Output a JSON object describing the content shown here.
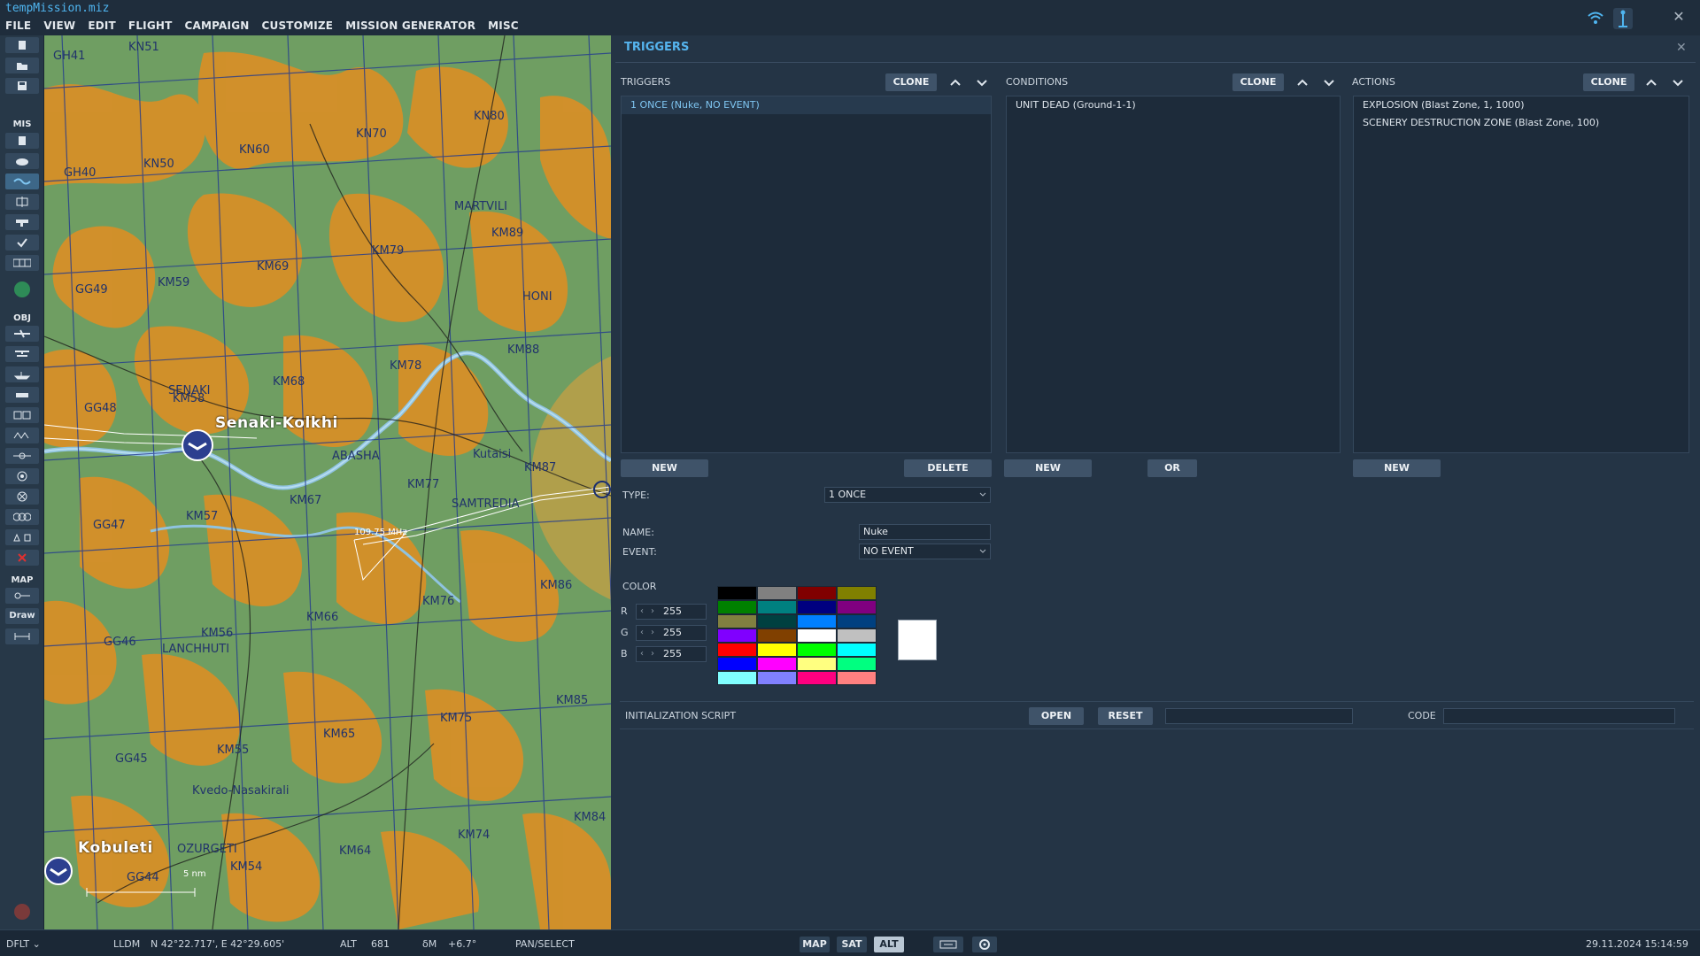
{
  "app": {
    "title": "tempMission.miz"
  },
  "menu": [
    "FILE",
    "VIEW",
    "EDIT",
    "FLIGHT",
    "CAMPAIGN",
    "CUSTOMIZE",
    "MISSION GENERATOR",
    "MISC"
  ],
  "toolbar": {
    "sections": {
      "mis": "MIS",
      "obj": "OBJ",
      "map": "MAP"
    },
    "draw_label": "Draw"
  },
  "map": {
    "grid_labels": [
      "GH41",
      "KN51",
      "GH40",
      "KN50",
      "KN60",
      "KN70",
      "KN80",
      "KM59",
      "KM69",
      "KM79",
      "KM89",
      "GG49",
      "KM68",
      "KM78",
      "KM88",
      "GG48",
      "KM58",
      "KM77",
      "KM87",
      "GG47",
      "KM57",
      "KM67",
      "KM76",
      "KM86",
      "GG46",
      "KM56",
      "KM66",
      "KM75",
      "KM85",
      "GG45",
      "KM55",
      "KM65",
      "KM74",
      "KM84",
      "GG44",
      "KM54",
      "KM64"
    ],
    "towns": [
      "MARTVILI",
      "HONI",
      "SENAKI",
      "ABASHA",
      "Kutaisi",
      "SAMTREDIA",
      "LANCHHUTI",
      "Kvedo-Nasakirali",
      "OZURGETI"
    ],
    "airbases": [
      "Senaki-Kolkhi",
      "Kobuleti"
    ],
    "annotations": [
      "109.75 MHz",
      "5 nm"
    ]
  },
  "panel": {
    "title": "TRIGGERS",
    "triggers": {
      "label": "TRIGGERS",
      "clone": "CLONE",
      "items": [
        "1 ONCE (Nuke, NO EVENT)"
      ],
      "selected_index": 0,
      "new": "NEW",
      "delete": "DELETE"
    },
    "conditions": {
      "label": "CONDITIONS",
      "clone": "CLONE",
      "items": [
        "UNIT DEAD (Ground-1-1)"
      ],
      "new": "NEW",
      "or": "OR"
    },
    "actions": {
      "label": "ACTIONS",
      "clone": "CLONE",
      "items": [
        "EXPLOSION (Blast Zone, 1, 1000)",
        "SCENERY DESTRUCTION ZONE (Blast Zone, 100)"
      ],
      "new": "NEW"
    },
    "form": {
      "type_label": "TYPE:",
      "type_value": "1 ONCE",
      "name_label": "NAME:",
      "name_value": "Nuke",
      "event_label": "EVENT:",
      "event_value": "NO EVENT",
      "color_label": "COLOR",
      "r_label": "R",
      "r_value": "255",
      "g_label": "G",
      "g_value": "255",
      "b_label": "B",
      "b_value": "255",
      "preview_color": "#ffffff",
      "palette": [
        "#000000",
        "#808080",
        "#800000",
        "#808000",
        "#008000",
        "#008080",
        "#000080",
        "#800080",
        "#808040",
        "#004040",
        "#0080ff",
        "#004080",
        "#8000ff",
        "#804000",
        "#ffffff",
        "#c0c0c0",
        "#ff0000",
        "#ffff00",
        "#00ff00",
        "#00ffff",
        "#0000ff",
        "#ff00ff",
        "#ffff80",
        "#00ff80",
        "#80ffff",
        "#8080ff",
        "#ff0080",
        "#ff8080"
      ]
    },
    "init_script": {
      "label": "INITIALIZATION SCRIPT",
      "open": "OPEN",
      "reset": "RESET",
      "code_label": "CODE"
    }
  },
  "status": {
    "mode": "DFLT",
    "coord_format": "LLDM",
    "coords": "N 42°22.717', E 42°29.605'",
    "alt_label": "ALT",
    "alt_value": "681",
    "mag_label": "δM",
    "mag_value": "+6.7°",
    "tool": "PAN/SELECT",
    "map_btn": "MAP",
    "sat_btn": "SAT",
    "alt_btn": "ALT",
    "datetime": "29.11.2024 15:14:59"
  }
}
